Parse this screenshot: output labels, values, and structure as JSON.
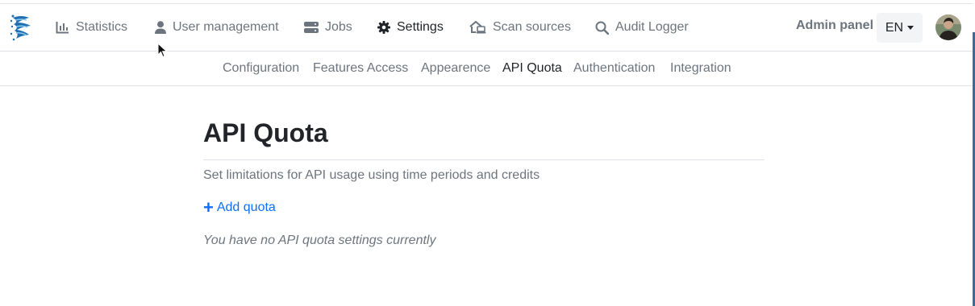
{
  "navbar": {
    "items": [
      {
        "label": "Statistics",
        "icon": "chart-line-icon",
        "active": false
      },
      {
        "label": "User management",
        "icon": "user-icon",
        "active": false
      },
      {
        "label": "Jobs",
        "icon": "server-icon",
        "active": false
      },
      {
        "label": "Settings",
        "icon": "gear-icon",
        "active": true
      },
      {
        "label": "Scan sources",
        "icon": "house-laptop-icon",
        "active": false
      },
      {
        "label": "Audit Logger",
        "icon": "search-icon",
        "active": false
      }
    ],
    "admin_label": "Admin panel",
    "language": "EN"
  },
  "subnav": {
    "items": [
      {
        "label": "Configuration",
        "active": false
      },
      {
        "label": "Features Access",
        "active": false
      },
      {
        "label": "Appearence",
        "active": false
      },
      {
        "label": "API Quota",
        "active": true
      },
      {
        "label": "Authentication",
        "active": false
      },
      {
        "label": "Integration",
        "active": false
      }
    ]
  },
  "main": {
    "title": "API Quota",
    "description": "Set limitations for API usage using time periods and credits",
    "add_button_label": "Add quota",
    "add_button_icon": "plus-icon",
    "empty_message": "You have no API quota settings currently"
  },
  "colors": {
    "text_primary": "#212529",
    "text_muted": "#6c757d",
    "link": "#0d6efd",
    "border": "#dee2e6"
  }
}
